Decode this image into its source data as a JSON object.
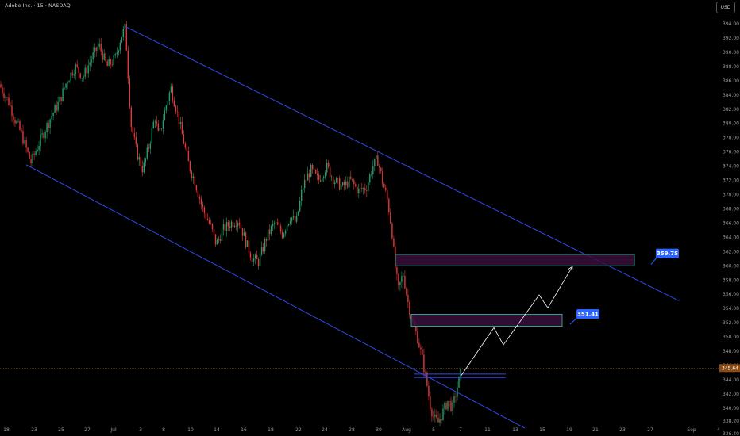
{
  "header": {
    "title": "Adobe Inc. · 15 · NASDAQ",
    "currency": "USD"
  },
  "colors": {
    "background": "#000000",
    "channel": "#3049e8",
    "zone_fill": "#3a0f3a",
    "zone_border": "#36c9a8",
    "up_candle": "#22a06b",
    "down_candle": "#e23a3a",
    "label_bg": "#2962ff",
    "current_price_line": "#7a4a1a",
    "projection": "#ffffff",
    "support_line": "#3049e8"
  },
  "chart_data": {
    "type": "candlestick",
    "ylim": [
      334.6,
      395.5
    ],
    "y_ticks": [
      "394.00",
      "392.00",
      "390.00",
      "388.00",
      "386.00",
      "384.00",
      "382.00",
      "380.00",
      "378.00",
      "376.00",
      "374.00",
      "372.00",
      "370.00",
      "368.00",
      "366.00",
      "364.00",
      "362.00",
      "360.00",
      "358.00",
      "356.00",
      "354.00",
      "352.00",
      "350.00",
      "348.00",
      "346.00",
      "344.00",
      "342.00",
      "340.00",
      "338.20",
      "336.40",
      "334.70"
    ],
    "x_ticks": [
      "18",
      "23",
      "25",
      "27",
      "Jul",
      "3",
      "8",
      "10",
      "14",
      "16",
      "18",
      "22",
      "24",
      "28",
      "30",
      "Aug",
      "5",
      "7",
      "11",
      "13",
      "15",
      "19",
      "21",
      "23",
      "27",
      "Sep",
      "4"
    ],
    "price_path": [
      [
        0,
        385.5
      ],
      [
        0.012,
        383
      ],
      [
        0.02,
        380.5
      ],
      [
        0.028,
        378.5
      ],
      [
        0.035,
        376
      ],
      [
        0.04,
        374.5
      ],
      [
        0.047,
        376.5
      ],
      [
        0.055,
        378.5
      ],
      [
        0.065,
        381
      ],
      [
        0.075,
        383
      ],
      [
        0.085,
        386
      ],
      [
        0.095,
        388
      ],
      [
        0.105,
        386.5
      ],
      [
        0.115,
        389
      ],
      [
        0.125,
        391
      ],
      [
        0.135,
        388
      ],
      [
        0.145,
        389
      ],
      [
        0.152,
        392
      ],
      [
        0.158,
        393.5
      ],
      [
        0.165,
        380
      ],
      [
        0.172,
        376
      ],
      [
        0.18,
        373.5
      ],
      [
        0.188,
        377
      ],
      [
        0.195,
        381
      ],
      [
        0.2,
        378
      ],
      [
        0.208,
        382
      ],
      [
        0.215,
        385
      ],
      [
        0.222,
        382
      ],
      [
        0.23,
        378
      ],
      [
        0.238,
        374
      ],
      [
        0.245,
        372
      ],
      [
        0.255,
        368
      ],
      [
        0.265,
        365.5
      ],
      [
        0.272,
        363
      ],
      [
        0.28,
        365
      ],
      [
        0.29,
        366
      ],
      [
        0.3,
        366.5
      ],
      [
        0.31,
        363
      ],
      [
        0.318,
        361
      ],
      [
        0.325,
        360.5
      ],
      [
        0.335,
        364
      ],
      [
        0.345,
        366
      ],
      [
        0.355,
        364.5
      ],
      [
        0.365,
        367
      ],
      [
        0.372,
        366
      ],
      [
        0.38,
        371
      ],
      [
        0.39,
        373.5
      ],
      [
        0.4,
        372
      ],
      [
        0.41,
        374
      ],
      [
        0.42,
        372
      ],
      [
        0.43,
        371
      ],
      [
        0.44,
        372
      ],
      [
        0.45,
        370.5
      ],
      [
        0.46,
        371
      ],
      [
        0.468,
        374
      ],
      [
        0.474,
        375
      ],
      [
        0.48,
        372
      ],
      [
        0.487,
        369
      ],
      [
        0.492,
        365
      ],
      [
        0.495,
        361
      ],
      [
        0.5,
        356.5
      ],
      [
        0.506,
        359
      ],
      [
        0.512,
        355
      ],
      [
        0.518,
        352
      ],
      [
        0.524,
        350
      ],
      [
        0.53,
        347
      ],
      [
        0.535,
        344
      ],
      [
        0.54,
        340.5
      ],
      [
        0.545,
        338.5
      ],
      [
        0.55,
        338
      ],
      [
        0.556,
        339.5
      ],
      [
        0.562,
        341
      ],
      [
        0.568,
        340
      ],
      [
        0.574,
        343
      ],
      [
        0.578,
        344.8
      ]
    ],
    "channel_upper": [
      [
        158,
        393.6
      ],
      [
        855,
        355.1
      ]
    ],
    "channel_lower": [
      [
        33,
        374.2
      ],
      [
        661,
        337.2
      ]
    ],
    "current_price": "345.64",
    "zones": [
      {
        "x1": 498,
        "x2": 799,
        "y_top": 361.6,
        "y_bottom": 360.0
      },
      {
        "x1": 518,
        "x2": 708,
        "y_top": 353.2,
        "y_bottom": 351.5
      }
    ],
    "support_lines": [
      {
        "x1": 522,
        "x2": 637,
        "y": 344.8
      },
      {
        "x1": 522,
        "x2": 637,
        "y": 344.3
      }
    ],
    "projection": [
      [
        581,
        344.6
      ],
      [
        622,
        351.3
      ],
      [
        634,
        348.9
      ],
      [
        679,
        355.9
      ],
      [
        690,
        354.1
      ],
      [
        721,
        359.9
      ]
    ],
    "price_labels": [
      {
        "text": "359.75",
        "x": 826,
        "y": 362.3,
        "tail_to": [
          820,
          360.2
        ]
      },
      {
        "text": "351.41",
        "x": 726,
        "y": 353.8,
        "tail_to": [
          718,
          351.8
        ]
      }
    ]
  }
}
